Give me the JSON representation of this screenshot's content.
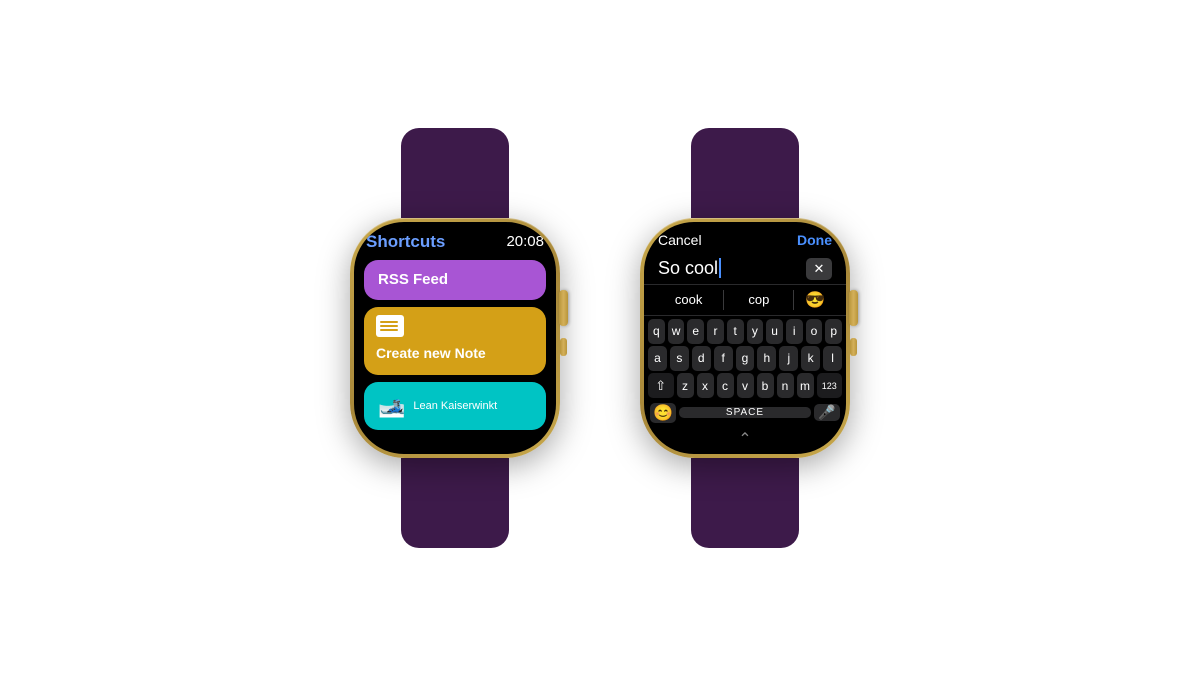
{
  "watch_left": {
    "title": "Shortcuts",
    "time": "20:08",
    "items": [
      {
        "id": "rss",
        "label": "RSS Feed",
        "color": "#a855d4"
      },
      {
        "id": "note",
        "label": "Create new Note",
        "color": "#d4a017"
      },
      {
        "id": "ski",
        "label": "Lean Kaiserwinkt",
        "color": "#00c4c4"
      }
    ]
  },
  "watch_right": {
    "cancel_label": "Cancel",
    "done_label": "Done",
    "input_text": "So cool",
    "suggestions": [
      "cook",
      "cop",
      "😎"
    ],
    "rows": [
      [
        "q",
        "w",
        "e",
        "r",
        "t",
        "y",
        "u",
        "i",
        "o",
        "p"
      ],
      [
        "a",
        "s",
        "d",
        "f",
        "g",
        "h",
        "j",
        "k",
        "l"
      ],
      [
        "⇧",
        "z",
        "x",
        "c",
        "v",
        "b",
        "n",
        "m",
        "123"
      ],
      [
        "😊",
        "SPACE",
        "🎤"
      ]
    ],
    "backspace": "⌫",
    "chevron": "⌃",
    "space_label": "SPACE"
  }
}
